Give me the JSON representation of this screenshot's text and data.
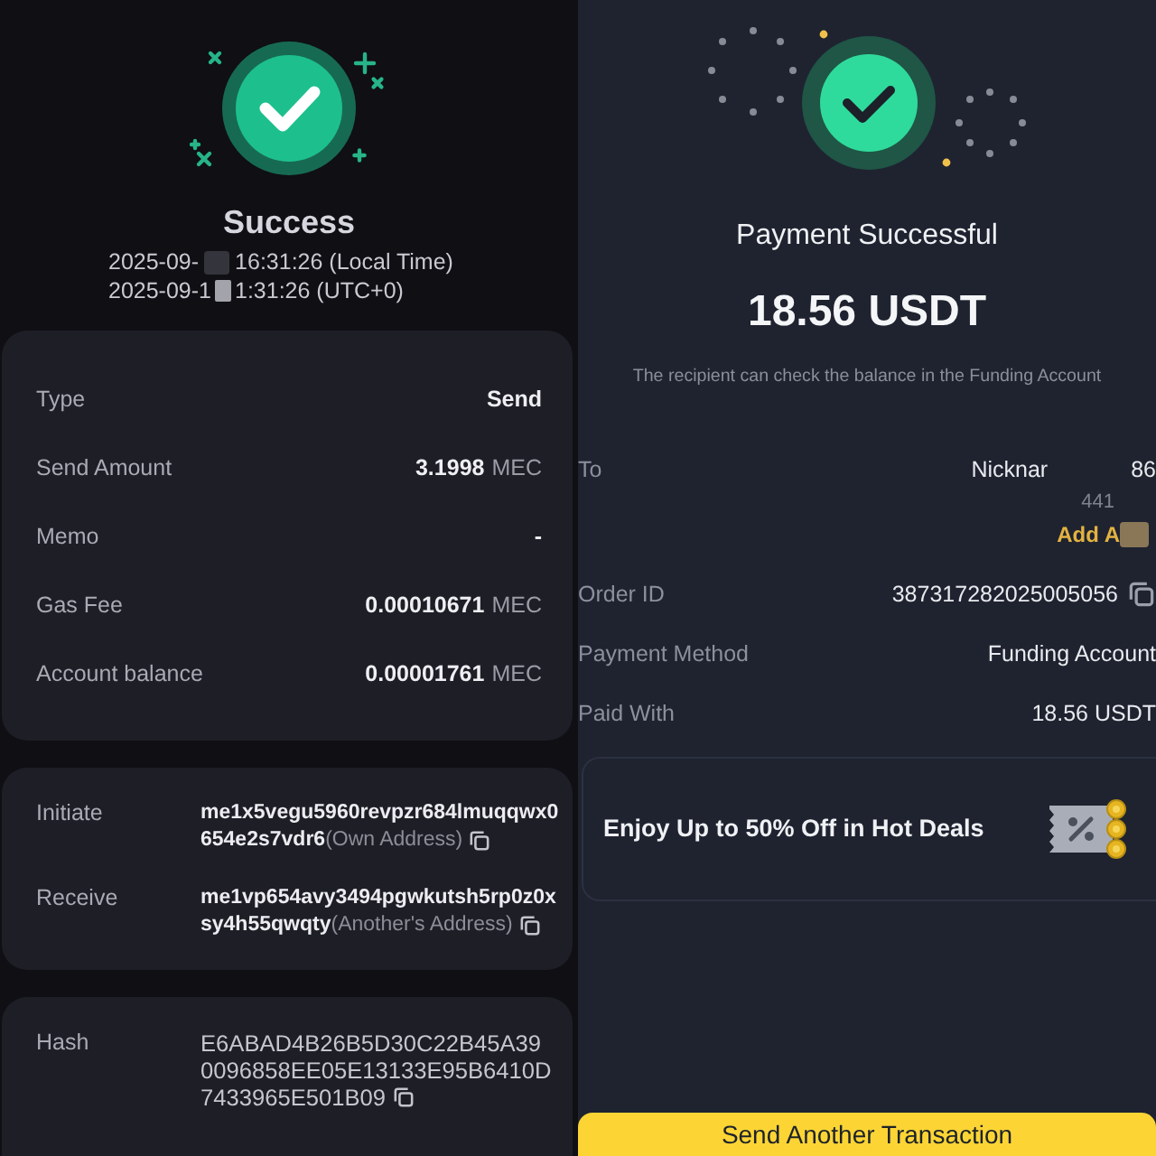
{
  "left": {
    "status": "Success",
    "times": [
      {
        "start": "2025-09-",
        "end": "16:31:26 (Local Time)"
      },
      {
        "start": "2025-09-1",
        "end": "1:31:26 (UTC+0)"
      }
    ],
    "details": [
      {
        "label": "Type",
        "value": "Send"
      },
      {
        "label": "Send Amount",
        "value": "3.1998",
        "unit": "MEC"
      },
      {
        "label": "Memo",
        "value": "-"
      },
      {
        "label": "Gas Fee",
        "value": "0.00010671",
        "unit": "MEC"
      },
      {
        "label": "Account balance",
        "value": "0.00001761",
        "unit": "MEC"
      }
    ],
    "addresses": [
      {
        "label": "Initiate",
        "address_lines": [
          "me1x5vegu5960revpzr684lmuqqwx0",
          "654e2s7vdr6"
        ],
        "note": "(Own Address)"
      },
      {
        "label": "Receive",
        "address_lines": [
          "me1vp654avy3494pgwkutsh5rp0z0x",
          "sy4h55qwqty"
        ],
        "note": "(Another's Address)"
      }
    ],
    "hash": {
      "label": "Hash",
      "lines": [
        "E6ABAD4B26B5D30C22B45A39",
        "0096858EE05E13133E95B6410D",
        "7433965E501B09"
      ]
    }
  },
  "right": {
    "title": "Payment Successful",
    "amount": "18.56 USDT",
    "note": "The recipient can check the balance in the Funding Account",
    "recipient": {
      "label": "To",
      "name_parts": [
        "Nicknar",
        "86"
      ],
      "detail": "441",
      "action": "Add A"
    },
    "details": [
      {
        "label": "Order ID",
        "value": "387317282025005056",
        "copyable": true
      },
      {
        "label": "Payment Method",
        "value": "Funding Account",
        "copyable": false
      },
      {
        "label": "Paid With",
        "value": "18.56 USDT",
        "copyable": false
      }
    ],
    "promo": {
      "text": "Enjoy Up to 50% Off in Hot Deals"
    },
    "button": {
      "label": "Send Another Transaction"
    }
  }
}
